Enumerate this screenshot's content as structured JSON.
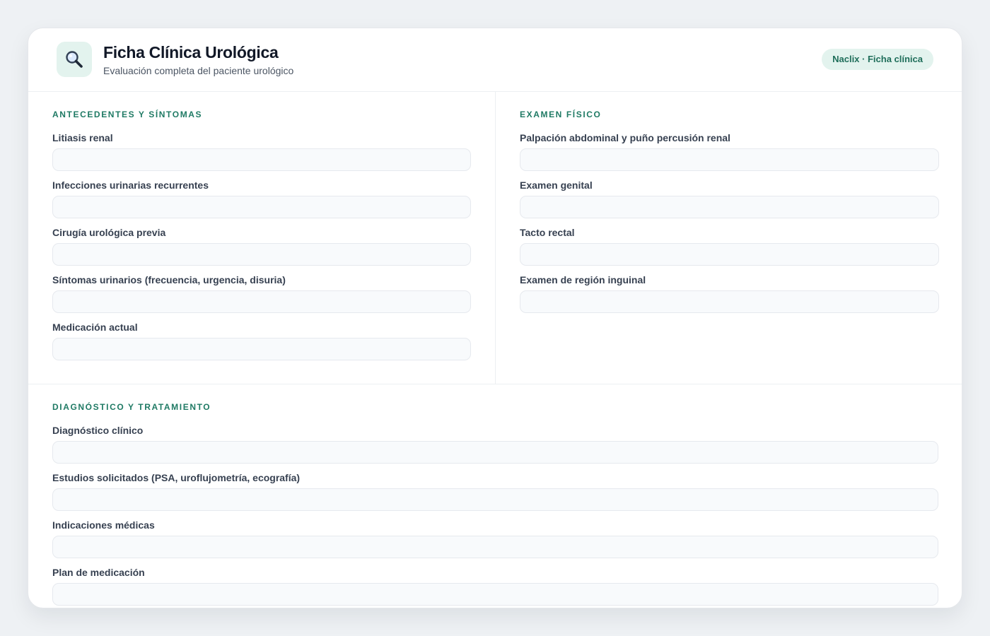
{
  "header": {
    "icon": "magnifier-icon",
    "title": "Ficha Clínica Urológica",
    "subtitle": "Evaluación completa del paciente urológico",
    "badge": "Naclix · Ficha clínica"
  },
  "colors": {
    "accent": "#1f7a64",
    "accent_bg": "#e3f3ee",
    "input_bg": "#f8fafc"
  },
  "sections": {
    "antecedentes": {
      "title": "ANTECEDENTES Y SÍNTOMAS",
      "fields": [
        {
          "label": "Litiasis renal",
          "value": ""
        },
        {
          "label": "Infecciones urinarias recurrentes",
          "value": ""
        },
        {
          "label": "Cirugía urológica previa",
          "value": ""
        },
        {
          "label": "Síntomas urinarios (frecuencia, urgencia, disuria)",
          "value": ""
        },
        {
          "label": "Medicación actual",
          "value": ""
        }
      ]
    },
    "examen": {
      "title": "EXAMEN FÍSICO",
      "fields": [
        {
          "label": "Palpación abdominal y puño percusión renal",
          "value": ""
        },
        {
          "label": "Examen genital",
          "value": ""
        },
        {
          "label": "Tacto rectal",
          "value": ""
        },
        {
          "label": "Examen de región inguinal",
          "value": ""
        }
      ]
    },
    "diagnostico": {
      "title": "DIAGNÓSTICO Y TRATAMIENTO",
      "fields": [
        {
          "label": "Diagnóstico clínico",
          "value": ""
        },
        {
          "label": "Estudios solicitados (PSA, uroflujometría, ecografía)",
          "value": ""
        },
        {
          "label": "Indicaciones médicas",
          "value": ""
        },
        {
          "label": "Plan de medicación",
          "value": ""
        }
      ]
    }
  }
}
